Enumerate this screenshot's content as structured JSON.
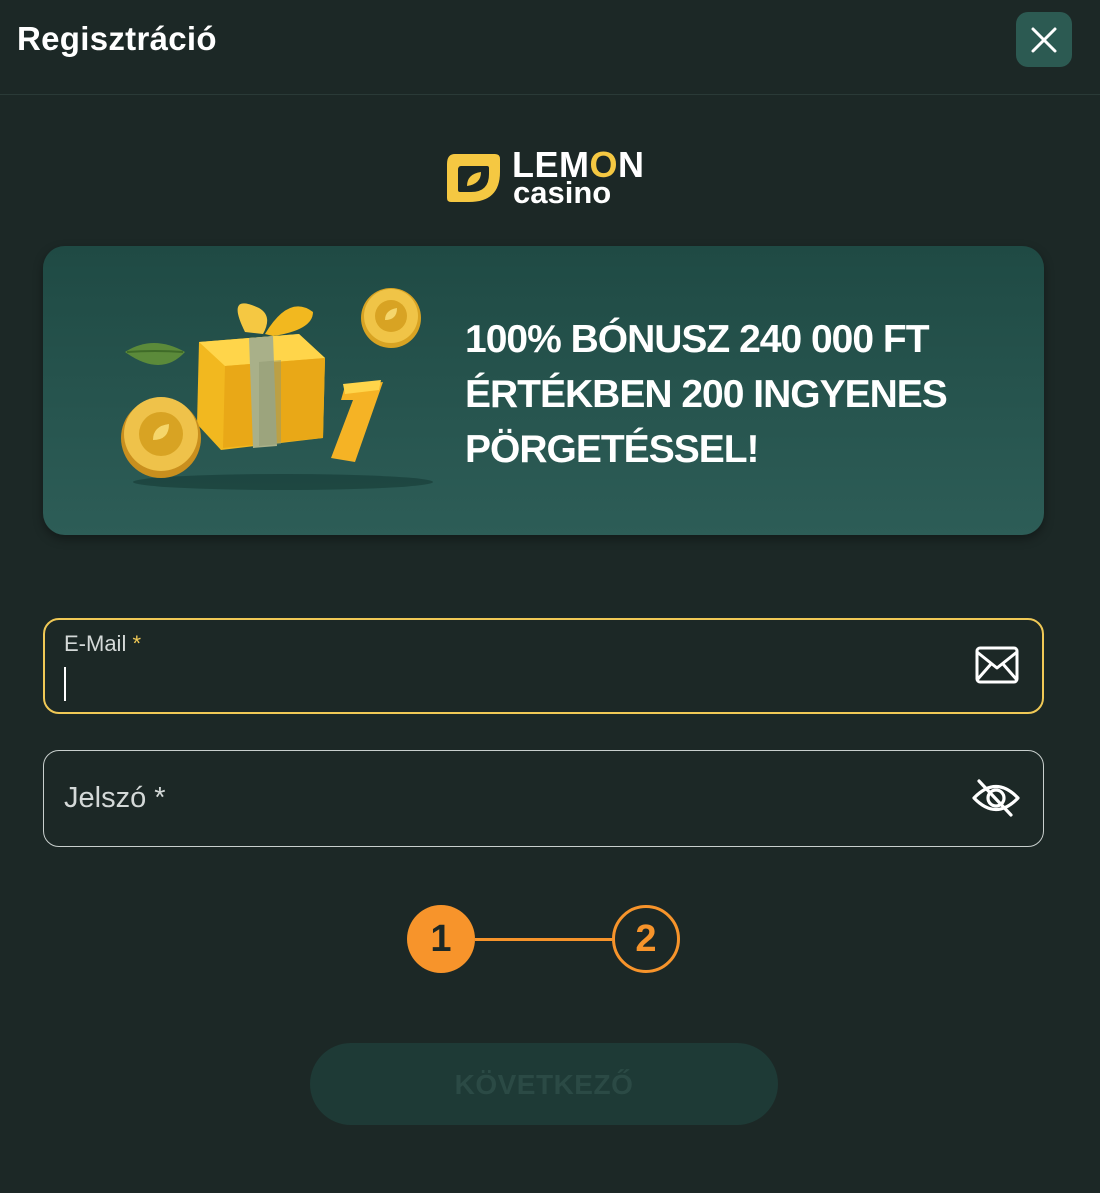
{
  "header": {
    "title": "Regisztráció",
    "close_icon": "close-icon"
  },
  "logo": {
    "word_main_prefix": "LEM",
    "word_main_accent": "O",
    "word_main_suffix": "N",
    "word_sub": "casino",
    "brand_color": "#f5c842"
  },
  "promo": {
    "lines": [
      "100% BÓNUSZ 240 000 FT",
      "ÉRTÉKBEN 200 INGYENES",
      "PÖRGETÉSSEL!"
    ]
  },
  "form": {
    "email": {
      "label": "E-Mail",
      "required_mark": "*",
      "value": "",
      "icon": "envelope-icon"
    },
    "password": {
      "label": "Jelszó *",
      "value": "",
      "icon": "eye-off-icon"
    }
  },
  "stepper": {
    "steps": [
      "1",
      "2"
    ],
    "current": 1,
    "accent": "#f7942b"
  },
  "next_button": {
    "label": "KÖVETKEZŐ",
    "disabled": true
  }
}
